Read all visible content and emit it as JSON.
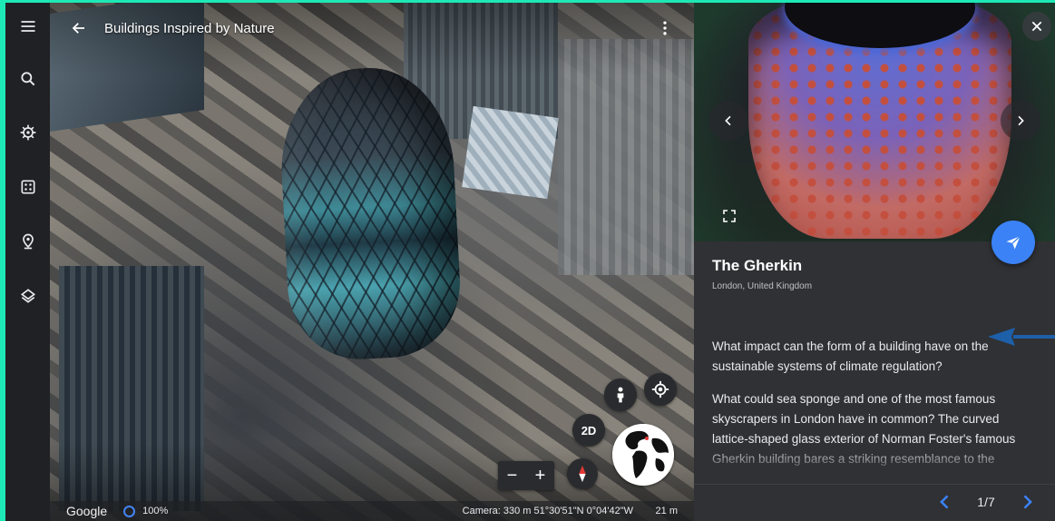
{
  "map": {
    "title": "Buildings Inspired by Nature",
    "twod_label": "2D",
    "zoom_in": "+",
    "zoom_out": "−"
  },
  "status": {
    "logo": "Google",
    "load_percent": "100%",
    "camera": "Camera: 330 m  51°30'51\"N 0°04'42\"W",
    "scale": "21 m"
  },
  "card": {
    "title": "The Gherkin",
    "subtitle": "London, United Kingdom",
    "paragraphs": [
      "What impact can the form of a building have on the sustainable systems of climate regulation?",
      "What could sea sponge and one of the most famous skyscrapers in London have in common? The curved lattice-shaped glass exterior of Norman Foster's famous Gherkin building bares a striking resemblance to the"
    ],
    "pager": "1/7"
  },
  "colors": {
    "accent_blue": "#3b82f6",
    "frame": "#1de9b6",
    "panel": "#303134",
    "rail": "#202124"
  },
  "icons": [
    "menu-icon",
    "search-icon",
    "voyager-icon",
    "dice-icon",
    "pin-icon",
    "layers-icon",
    "back-arrow-icon",
    "more-vert-icon",
    "pegman-icon",
    "my-location-icon",
    "compass-icon",
    "globe-icon",
    "close-icon",
    "chevron-left-icon",
    "chevron-right-icon",
    "fullscreen-icon",
    "share-icon"
  ]
}
